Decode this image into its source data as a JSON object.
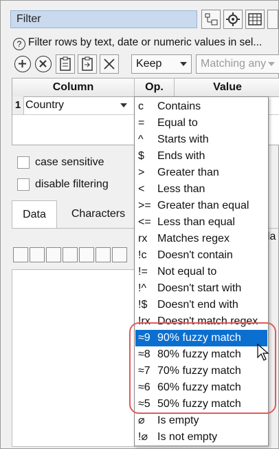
{
  "window": {
    "title": "Filter",
    "description": "Filter rows by text, date or numeric values in sel..."
  },
  "toolbar": {
    "keep_value": "Keep",
    "matching_value": "Matching any"
  },
  "table": {
    "headers": [
      "Column",
      "Op.",
      "Value"
    ],
    "rows": [
      {
        "num": "1",
        "column": "Country"
      }
    ]
  },
  "options": {
    "case_sensitive": "case sensitive",
    "disable_filtering": "disable filtering"
  },
  "tabs": [
    {
      "label": "Data",
      "active": true
    },
    {
      "label": "Characters",
      "active": false
    }
  ],
  "tab_tail_text": "la",
  "operator_menu": {
    "selected_index": 13,
    "items": [
      {
        "code": "c",
        "label": "Contains"
      },
      {
        "code": "=",
        "label": "Equal to"
      },
      {
        "code": "^",
        "label": "Starts with"
      },
      {
        "code": "$",
        "label": "Ends with"
      },
      {
        "code": ">",
        "label": "Greater than"
      },
      {
        "code": "<",
        "label": "Less than"
      },
      {
        "code": ">=",
        "label": "Greater than equal"
      },
      {
        "code": "<=",
        "label": "Less than equal"
      },
      {
        "code": "rx",
        "label": "Matches regex"
      },
      {
        "code": "!c",
        "label": "Doesn't contain"
      },
      {
        "code": "!=",
        "label": "Not equal to"
      },
      {
        "code": "!^",
        "label": "Doesn't start with"
      },
      {
        "code": "!$",
        "label": "Doesn't end with"
      },
      {
        "code": "!rx",
        "label": "Doesn't match regex"
      },
      {
        "code": "≈9",
        "label": "90% fuzzy match"
      },
      {
        "code": "≈8",
        "label": "80% fuzzy match"
      },
      {
        "code": "≈7",
        "label": "70% fuzzy match"
      },
      {
        "code": "≈6",
        "label": "60% fuzzy match"
      },
      {
        "code": "≈5",
        "label": "50% fuzzy match"
      },
      {
        "code": "⌀",
        "label": "Is empty"
      },
      {
        "code": "!⌀",
        "label": "Is not empty"
      }
    ]
  },
  "colors": {
    "selection": "#0b6fd0",
    "highlight": "#e05a5a",
    "title_bg": "#c9d9ee"
  }
}
